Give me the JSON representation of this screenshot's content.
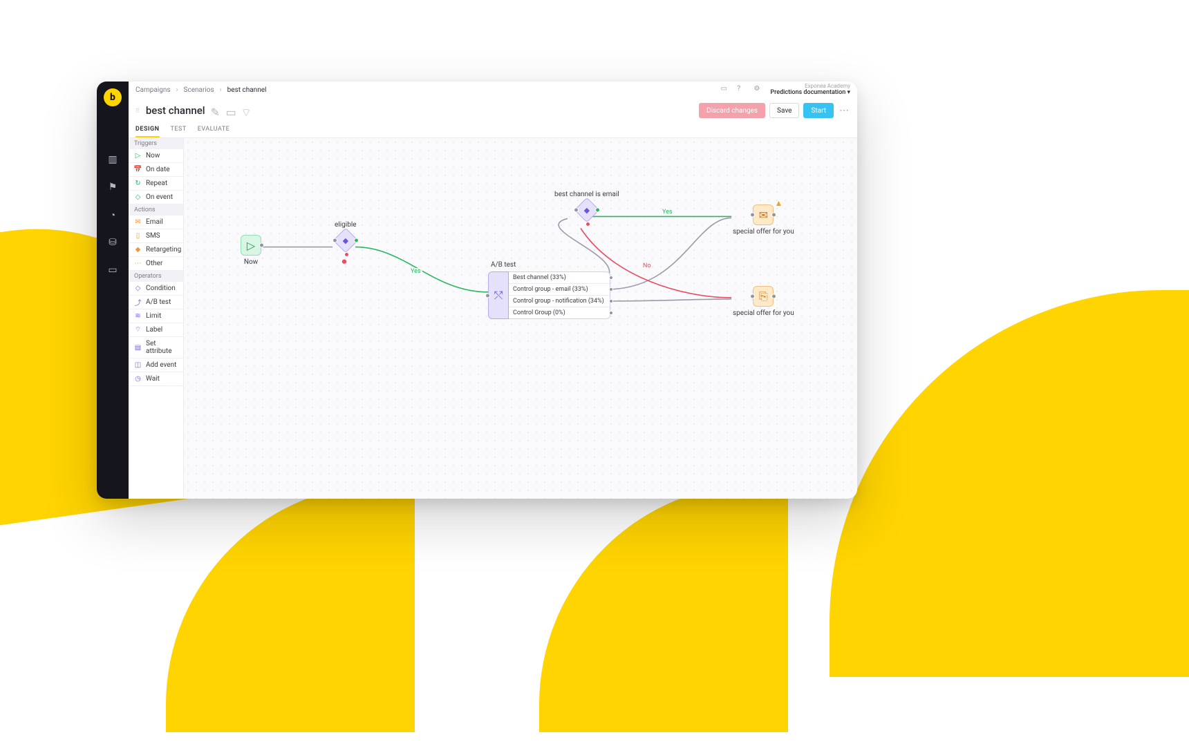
{
  "breadcrumbs": [
    "Campaigns",
    "Scenarios",
    "best channel"
  ],
  "header_meta": {
    "line1": "Exponea Academy",
    "line2": "Predictions documentation"
  },
  "title": "best channel",
  "buttons": {
    "discard": "Discard changes",
    "save": "Save",
    "start": "Start"
  },
  "tabs": [
    "DESIGN",
    "TEST",
    "EVALUATE"
  ],
  "active_tab": "DESIGN",
  "palette": {
    "sections": [
      {
        "name": "Triggers",
        "items": [
          {
            "label": "Now",
            "icon": "▷",
            "color": "#24b85f"
          },
          {
            "label": "On date",
            "icon": "📅",
            "color": "#7a7a83"
          },
          {
            "label": "Repeat",
            "icon": "↻",
            "color": "#24b85f"
          },
          {
            "label": "On event",
            "icon": "◇",
            "color": "#24b85f"
          }
        ]
      },
      {
        "name": "Actions",
        "items": [
          {
            "label": "Email",
            "icon": "✉",
            "color": "#e79b3b"
          },
          {
            "label": "SMS",
            "icon": "▯",
            "color": "#e79b3b"
          },
          {
            "label": "Retargeting",
            "icon": "◆",
            "color": "#e79b3b"
          },
          {
            "label": "Other",
            "icon": "⋯",
            "color": "#e79b3b"
          }
        ]
      },
      {
        "name": "Operators",
        "items": [
          {
            "label": "Condition",
            "icon": "◇",
            "color": "#7a63e0"
          },
          {
            "label": "A/B test",
            "icon": "⤴",
            "color": "#7a63e0"
          },
          {
            "label": "Limit",
            "icon": "≋",
            "color": "#7a63e0"
          },
          {
            "label": "Label",
            "icon": "⌔",
            "color": "#7a63e0"
          },
          {
            "label": "Set attribute",
            "icon": "▤",
            "color": "#7a63e0"
          },
          {
            "label": "Add event",
            "icon": "◫",
            "color": "#7a63e0"
          },
          {
            "label": "Wait",
            "icon": "◷",
            "color": "#7a63e0"
          }
        ]
      }
    ]
  },
  "canvas": {
    "nodes": {
      "now": {
        "label": "Now"
      },
      "eligible": {
        "label": "eligible"
      },
      "bestch": {
        "label": "best channel is email"
      },
      "email1": {
        "label": "special offer for you"
      },
      "notif1": {
        "label": "special offer for you"
      }
    },
    "abtest": {
      "title": "A/B test",
      "variants": [
        "Best channel (33%)",
        "Control group - email (33%)",
        "Control group - notification (34%)",
        "Control Group (0%)"
      ]
    },
    "edge_labels": {
      "yes1": "Yes",
      "yes2": "Yes",
      "no": "No"
    }
  }
}
